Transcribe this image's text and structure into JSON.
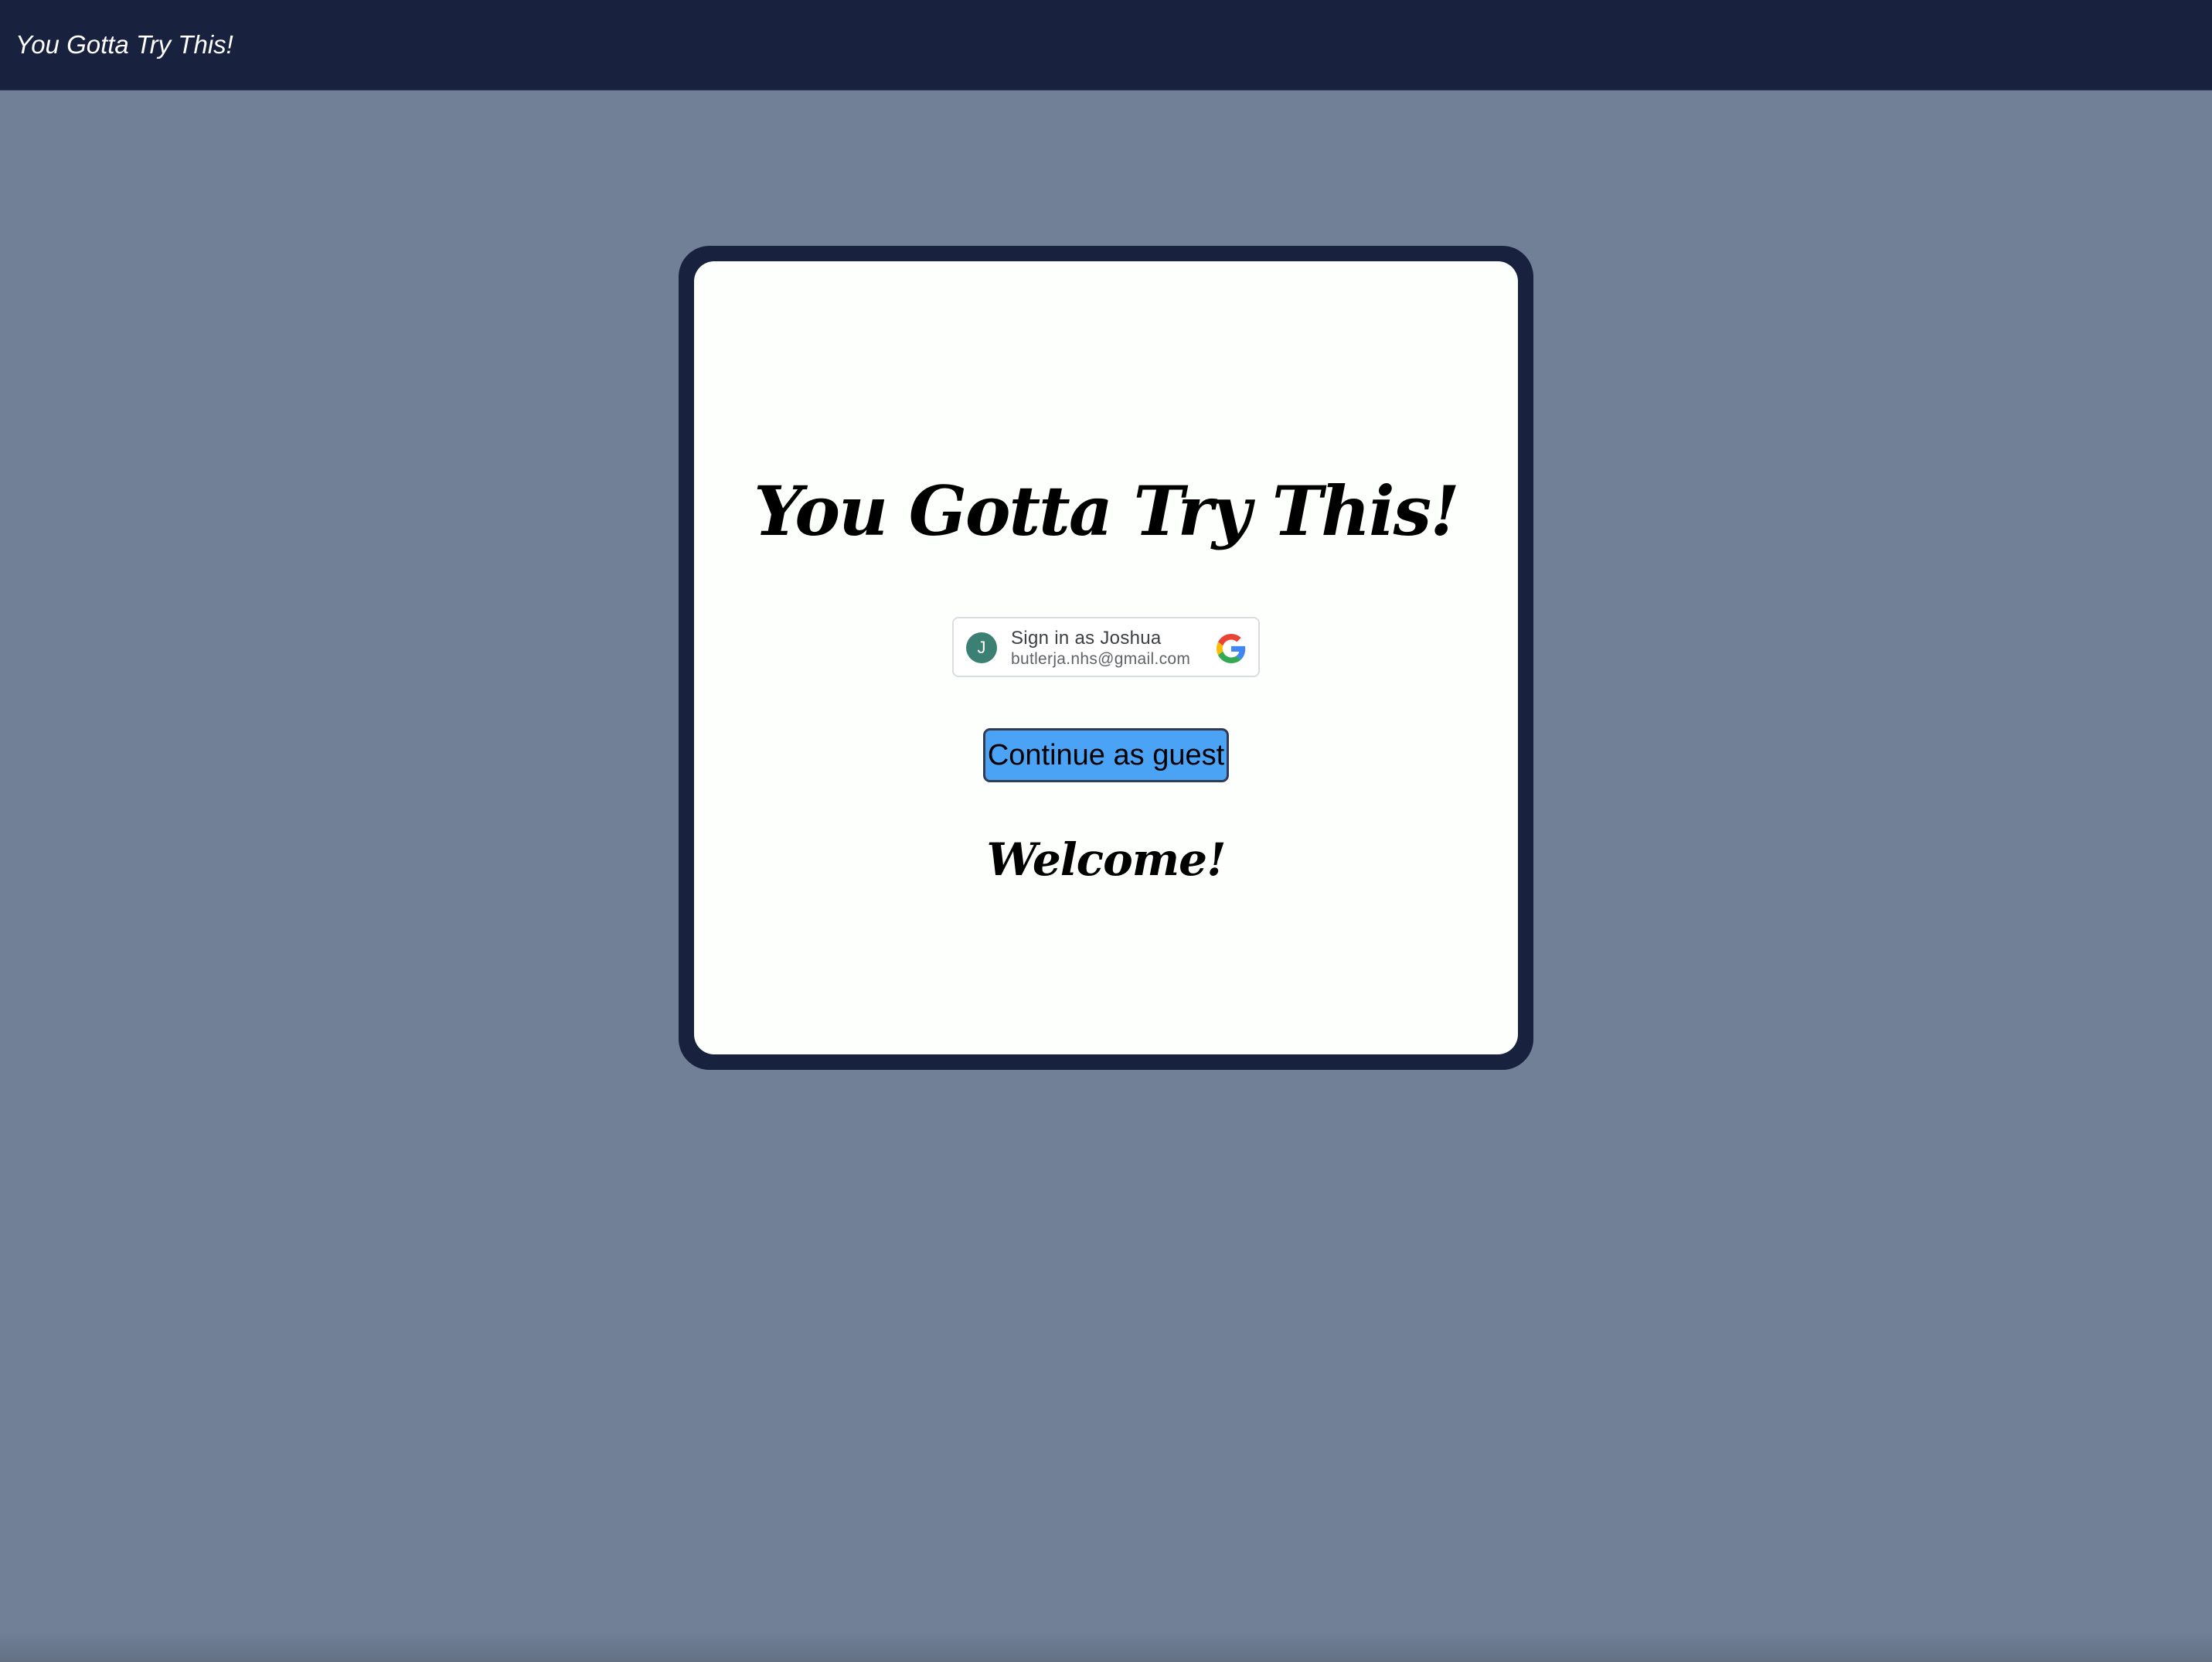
{
  "header": {
    "title": "You Gotta Try This!"
  },
  "card": {
    "title": "You Gotta Try This!",
    "google_signin": {
      "avatar_initial": "J",
      "label": "Sign in as Joshua",
      "email": "butlerja.nhs@gmail.com",
      "icon": "google-logo-icon"
    },
    "guest_button_label": "Continue as guest",
    "welcome_text": "Welcome!"
  },
  "colors": {
    "background": "#718097",
    "header": "#18213e",
    "card_border": "#18213e",
    "card_fill": "#fdfffc",
    "guest_button": "#4ba3f6",
    "avatar": "#3b8073"
  }
}
